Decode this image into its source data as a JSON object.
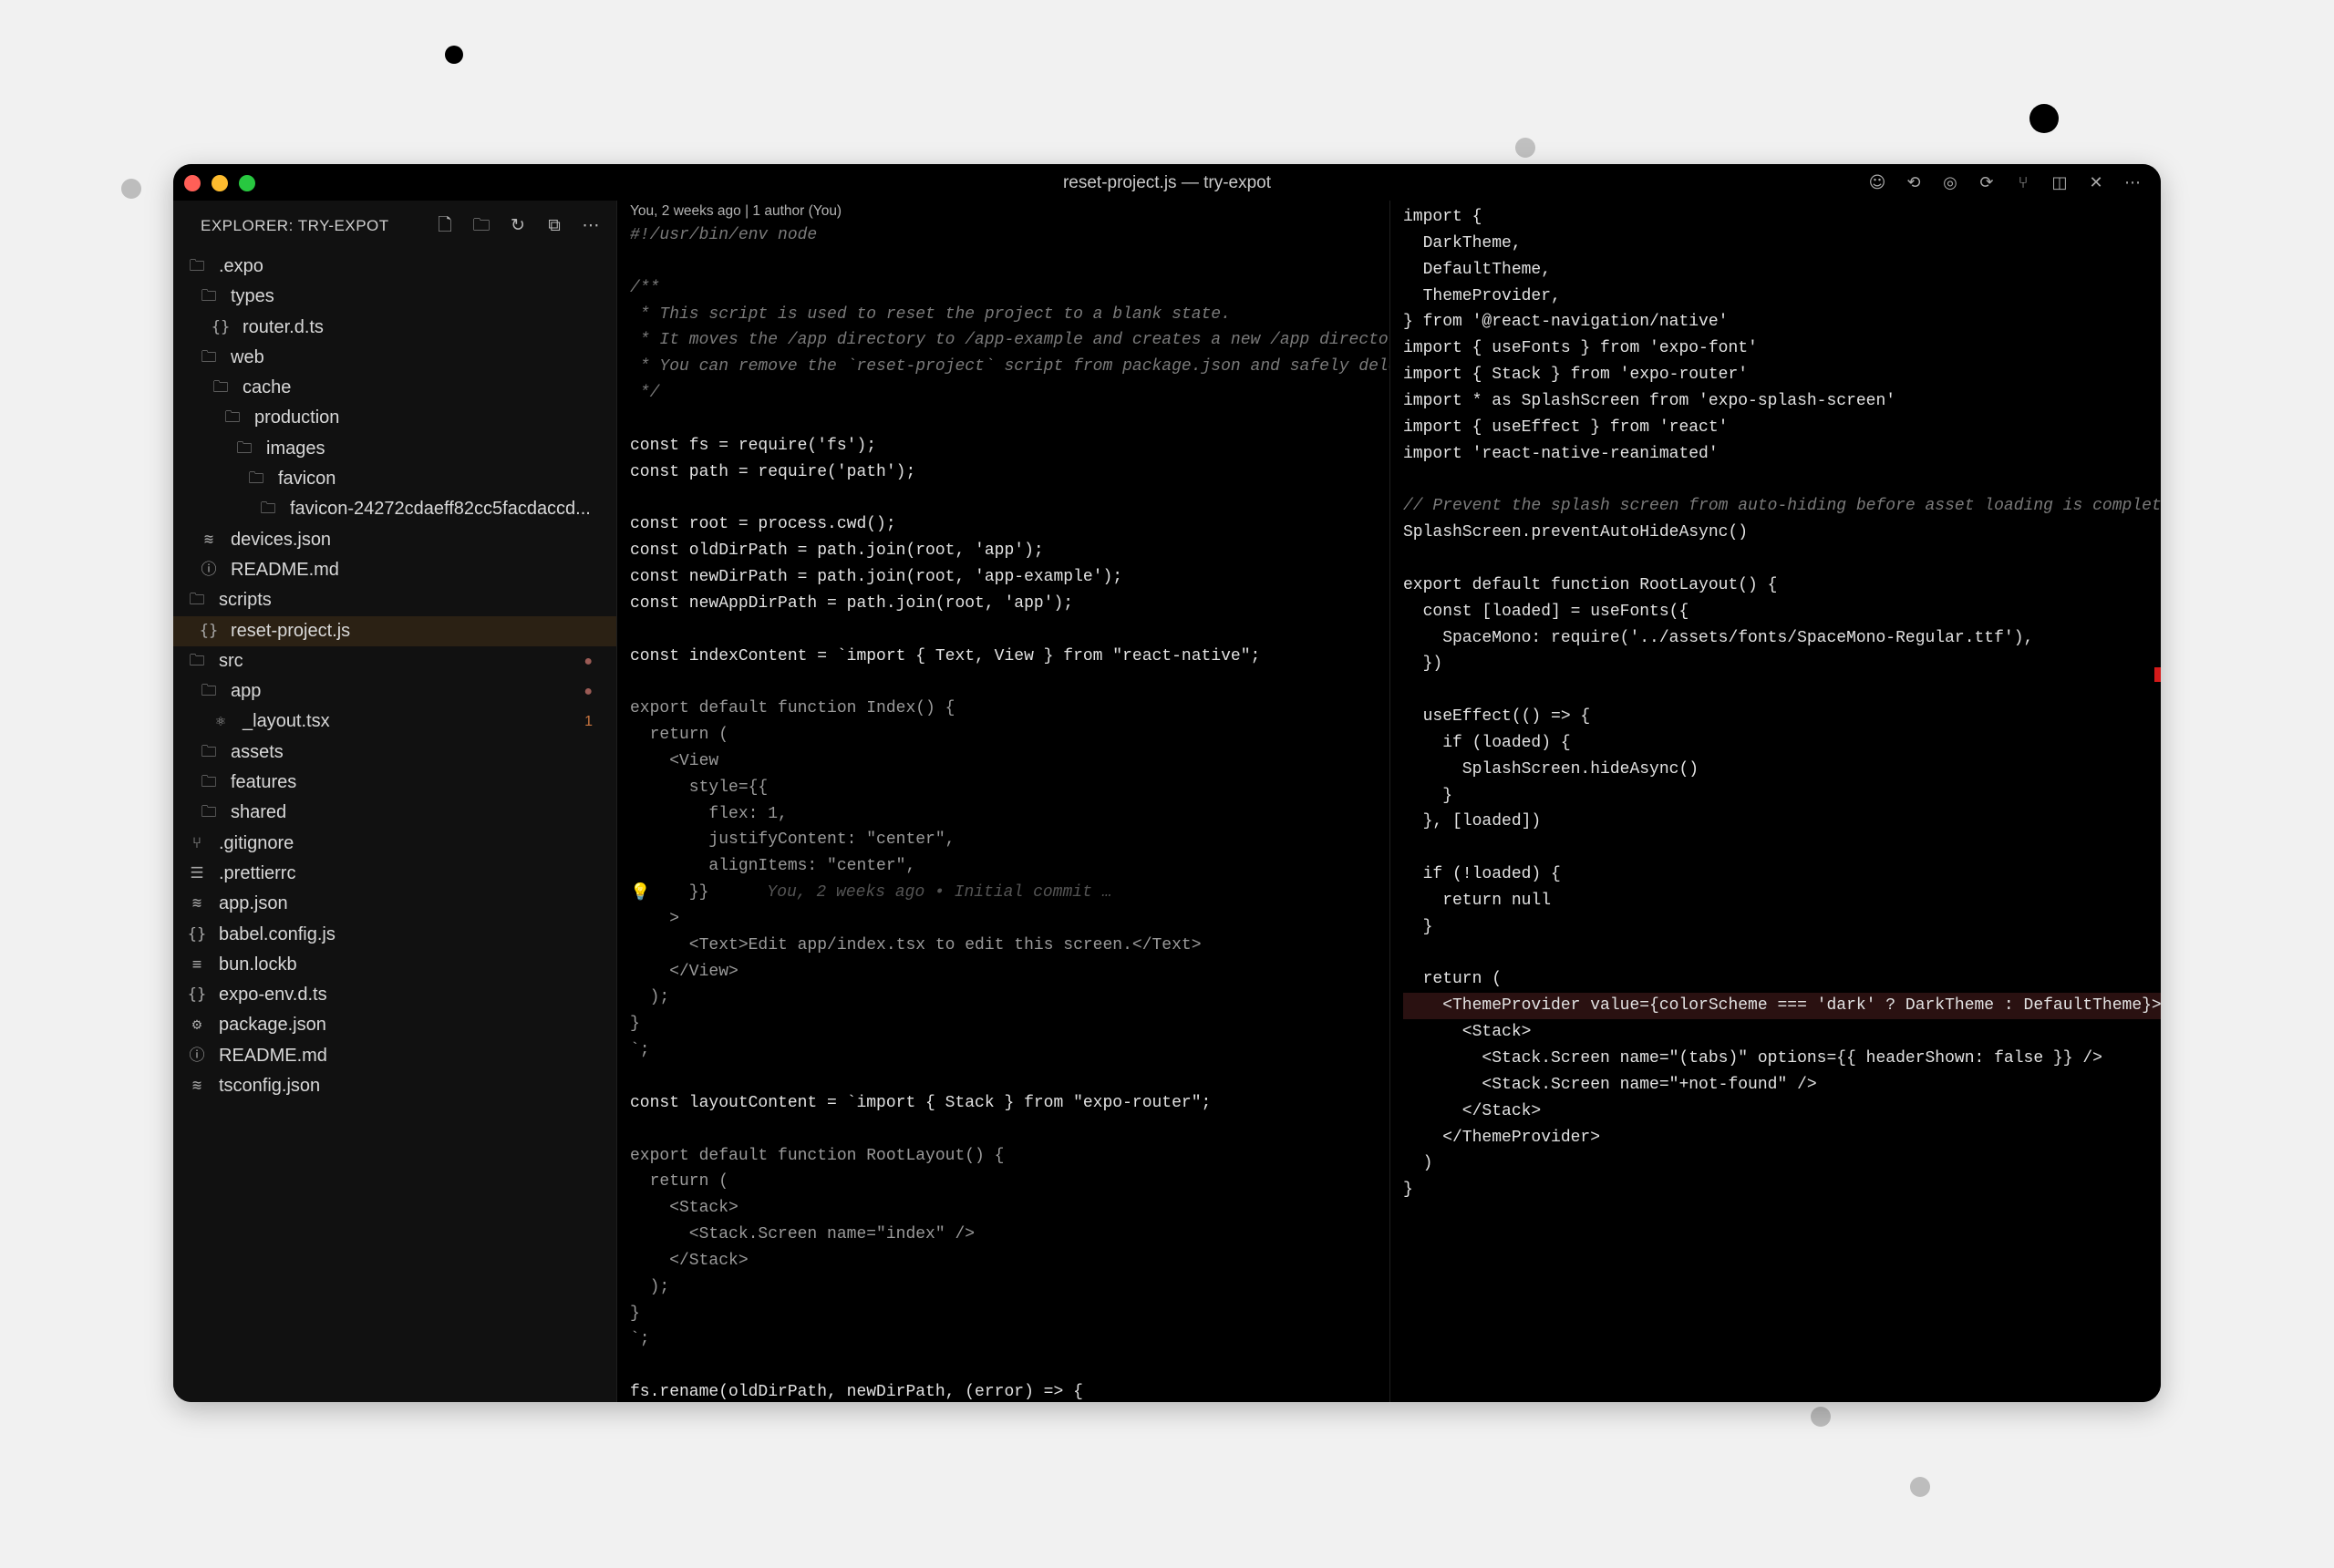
{
  "window": {
    "title": "reset-project.js — try-expot",
    "toolbar_icons": [
      "smiley-icon",
      "back-arrow-icon",
      "git-icon",
      "forward-arrow-icon",
      "branch-icon",
      "split-layout-icon",
      "close-icon",
      "more-icon"
    ]
  },
  "sidebar": {
    "header": "EXPLORER: TRY-EXPOT",
    "actions": [
      "new-file-icon",
      "new-folder-icon",
      "refresh-icon",
      "collapse-icon",
      "more-icon"
    ],
    "items": [
      {
        "label": ".expo",
        "icon": "folder-icon",
        "depth": 0
      },
      {
        "label": "types",
        "icon": "folder-icon",
        "depth": 1
      },
      {
        "label": "router.d.ts",
        "icon": "braces-icon",
        "depth": 2
      },
      {
        "label": "web",
        "icon": "folder-icon",
        "depth": 1
      },
      {
        "label": "cache",
        "icon": "folder-icon",
        "depth": 2
      },
      {
        "label": "production",
        "icon": "folder-icon",
        "depth": 3
      },
      {
        "label": "images",
        "icon": "folder-icon",
        "depth": 4
      },
      {
        "label": "favicon",
        "icon": "folder-icon",
        "depth": 5
      },
      {
        "label": "favicon-24272cdaeff82cc5facdaccd...",
        "icon": "folder-icon",
        "depth": 6
      },
      {
        "label": "devices.json",
        "icon": "database-icon",
        "depth": 1
      },
      {
        "label": "README.md",
        "icon": "info-icon",
        "depth": 1
      },
      {
        "label": "scripts",
        "icon": "folder-icon",
        "depth": 0
      },
      {
        "label": "reset-project.js",
        "icon": "braces-icon",
        "depth": 1,
        "selected": true
      },
      {
        "label": "src",
        "icon": "folder-icon",
        "depth": 0,
        "dot": true
      },
      {
        "label": "app",
        "icon": "folder-icon",
        "depth": 1,
        "dot": true
      },
      {
        "label": "_layout.tsx",
        "icon": "react-icon",
        "depth": 2,
        "count": "1"
      },
      {
        "label": "assets",
        "icon": "folder-icon",
        "depth": 1
      },
      {
        "label": "features",
        "icon": "folder-icon",
        "depth": 1
      },
      {
        "label": "shared",
        "icon": "folder-icon",
        "depth": 1
      },
      {
        "label": ".gitignore",
        "icon": "git-branch-icon",
        "depth": 0
      },
      {
        "label": ".prettierrc",
        "icon": "list-icon",
        "depth": 0
      },
      {
        "label": "app.json",
        "icon": "database-icon",
        "depth": 0
      },
      {
        "label": "babel.config.js",
        "icon": "braces-icon",
        "depth": 0
      },
      {
        "label": "bun.lockb",
        "icon": "lines-icon",
        "depth": 0
      },
      {
        "label": "expo-env.d.ts",
        "icon": "braces-icon",
        "depth": 0
      },
      {
        "label": "package.json",
        "icon": "gear-icon",
        "depth": 0
      },
      {
        "label": "README.md",
        "icon": "info-icon",
        "depth": 0
      },
      {
        "label": "tsconfig.json",
        "icon": "database-icon",
        "depth": 0
      }
    ]
  },
  "left_editor": {
    "blame": "You, 2 weeks ago | 1 author (You)",
    "inline_blame": "You, 2 weeks ago • Initial commit …",
    "lines": [
      "#!/usr/bin/env node",
      "",
      "/**",
      " * This script is used to reset the project to a blank state.",
      " * It moves the /app directory to /app-example and creates a new /app directory",
      " * You can remove the `reset-project` script from package.json and safely delete",
      " */",
      "",
      "const fs = require('fs');",
      "const path = require('path');",
      "",
      "const root = process.cwd();",
      "const oldDirPath = path.join(root, 'app');",
      "const newDirPath = path.join(root, 'app-example');",
      "const newAppDirPath = path.join(root, 'app');",
      "",
      "const indexContent = `import { Text, View } from \"react-native\";",
      "",
      "export default function Index() {",
      "  return (",
      "    <View",
      "      style={{",
      "        flex: 1,",
      "        justifyContent: \"center\",",
      "        alignItems: \"center\",",
      "      }}",
      "    >",
      "      <Text>Edit app/index.tsx to edit this screen.</Text>",
      "    </View>",
      "  );",
      "}",
      "`;",
      "",
      "const layoutContent = `import { Stack } from \"expo-router\";",
      "",
      "export default function RootLayout() {",
      "  return (",
      "    <Stack>",
      "      <Stack.Screen name=\"index\" />",
      "    </Stack>",
      "  );",
      "}",
      "`;",
      "",
      "fs.rename(oldDirPath, newDirPath, (error) => {"
    ]
  },
  "right_editor": {
    "lines": [
      "import {",
      "  DarkTheme,",
      "  DefaultTheme,",
      "  ThemeProvider,",
      "} from '@react-navigation/native'",
      "import { useFonts } from 'expo-font'",
      "import { Stack } from 'expo-router'",
      "import * as SplashScreen from 'expo-splash-screen'",
      "import { useEffect } from 'react'",
      "import 'react-native-reanimated'",
      "",
      "// Prevent the splash screen from auto-hiding before asset loading is complete.",
      "SplashScreen.preventAutoHideAsync()",
      "",
      "export default function RootLayout() {",
      "  const [loaded] = useFonts({",
      "    SpaceMono: require('../assets/fonts/SpaceMono-Regular.ttf'),",
      "  })",
      "",
      "  useEffect(() => {",
      "    if (loaded) {",
      "      SplashScreen.hideAsync()",
      "    }",
      "  }, [loaded])",
      "",
      "  if (!loaded) {",
      "    return null",
      "  }",
      "",
      "  return (",
      "    <ThemeProvider value={colorScheme === 'dark' ? DarkTheme : DefaultTheme}>",
      "      <Stack>",
      "        <Stack.Screen name=\"(tabs)\" options={{ headerShown: false }} />",
      "        <Stack.Screen name=\"+not-found\" />",
      "      </Stack>",
      "    </ThemeProvider>",
      "  )",
      "}"
    ]
  },
  "colors": {
    "background": "#f1f1f1",
    "window": "#000000",
    "sidebar": "#111111",
    "selected_row": "#2b2114",
    "close": "#ff5f57",
    "minimize": "#febc2e",
    "zoom": "#28c840",
    "error_marker": "#d31a1a"
  }
}
